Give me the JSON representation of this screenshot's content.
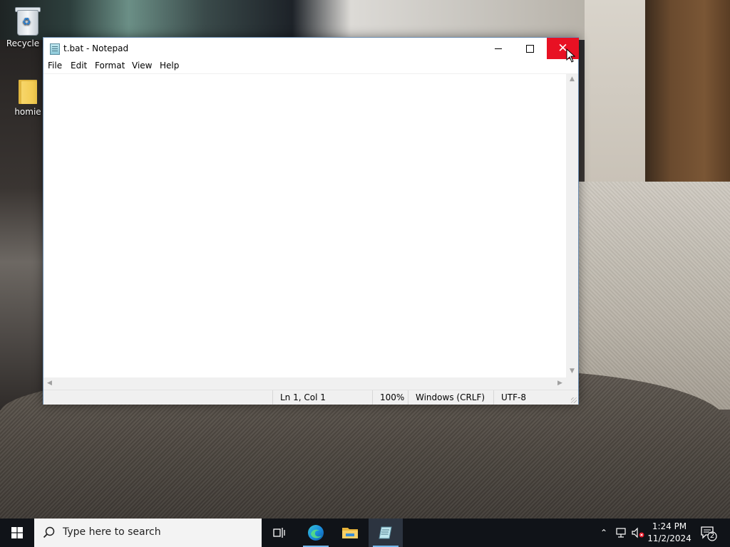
{
  "desktop": {
    "icons": [
      {
        "label": "Recycle B"
      },
      {
        "label": "homie"
      }
    ]
  },
  "window": {
    "title": "t.bat - Notepad",
    "menu": [
      "File",
      "Edit",
      "Format",
      "View",
      "Help"
    ],
    "content": "",
    "status": {
      "position": "Ln 1, Col 1",
      "zoom": "100%",
      "line_ending": "Windows (CRLF)",
      "encoding": "UTF-8"
    },
    "close_button_hovered": true
  },
  "taskbar": {
    "search_placeholder": "Type here to search",
    "pinned_apps": [
      "task-view",
      "edge",
      "file-explorer",
      "notepad"
    ],
    "active_app": "notepad",
    "clock_time": "1:24 PM",
    "clock_date": "11/2/2024",
    "notification_count": "2"
  },
  "colors": {
    "close_hover": "#e81123",
    "taskbar": "#101318",
    "accent": "#76b9ed"
  }
}
